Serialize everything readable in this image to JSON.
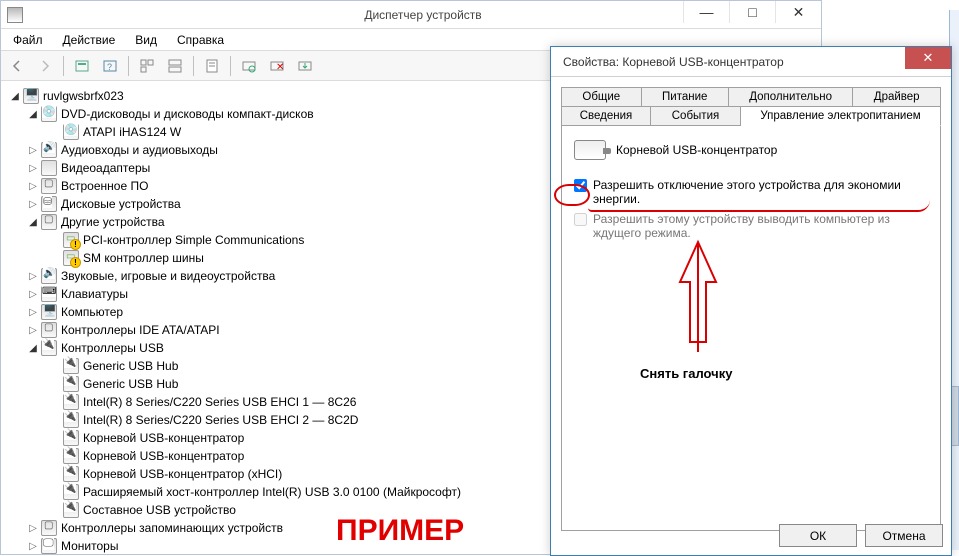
{
  "dm": {
    "title": "Диспетчер устройств",
    "menus": [
      "Файл",
      "Действие",
      "Вид",
      "Справка"
    ],
    "win_controls": {
      "min": "—",
      "max": "□",
      "close": "✕"
    },
    "root": "ruvlgwsbrfx023",
    "categories": [
      {
        "label": "DVD-дисководы и дисководы компакт-дисков",
        "expanded": true,
        "icon": "disc",
        "children": [
          {
            "label": "ATAPI iHAS124   W",
            "icon": "disc"
          }
        ]
      },
      {
        "label": "Аудиовходы и аудиовыходы",
        "icon": "sound"
      },
      {
        "label": "Видеоадаптеры",
        "icon": "video"
      },
      {
        "label": "Встроенное ПО",
        "icon": "chip"
      },
      {
        "label": "Дисковые устройства",
        "icon": "disk"
      },
      {
        "label": "Другие устройства",
        "expanded": true,
        "icon": "chip",
        "children": [
          {
            "label": "PCI-контроллер Simple Communications",
            "icon": "card",
            "warn": true
          },
          {
            "label": "SM контроллер шины",
            "icon": "card",
            "warn": true
          }
        ]
      },
      {
        "label": "Звуковые, игровые и видеоустройства",
        "icon": "sound"
      },
      {
        "label": "Клавиатуры",
        "icon": "keyboard"
      },
      {
        "label": "Компьютер",
        "icon": "computer"
      },
      {
        "label": "Контроллеры IDE ATA/ATAPI",
        "icon": "chip"
      },
      {
        "label": "Контроллеры USB",
        "expanded": true,
        "icon": "usb",
        "children": [
          {
            "label": "Generic USB Hub",
            "icon": "usb"
          },
          {
            "label": "Generic USB Hub",
            "icon": "usb"
          },
          {
            "label": "Intel(R) 8 Series/C220 Series USB EHCI 1 — 8C26",
            "icon": "usb"
          },
          {
            "label": "Intel(R) 8 Series/C220 Series USB EHCI 2 — 8C2D",
            "icon": "usb"
          },
          {
            "label": "Корневой USB-концентратор",
            "icon": "usb"
          },
          {
            "label": "Корневой USB-концентратор",
            "icon": "usb"
          },
          {
            "label": "Корневой USB-концентратор (xHCI)",
            "icon": "usb"
          },
          {
            "label": "Расширяемый хост-контроллер Intel(R) USB 3.0 0100 (Майкрософт)",
            "icon": "usb"
          },
          {
            "label": "Составное USB устройство",
            "icon": "usb"
          }
        ]
      },
      {
        "label": "Контроллеры запоминающих устройств",
        "icon": "chip"
      },
      {
        "label": "Мониторы",
        "icon": "monitor"
      }
    ]
  },
  "prop": {
    "title": "Свойства: Корневой USB-концентратор",
    "tabs_row1": [
      "Общие",
      "Питание",
      "Дополнительно",
      "Драйвер"
    ],
    "tabs_row2": [
      "Сведения",
      "События",
      "Управление электропитанием"
    ],
    "active_tab": "Управление электропитанием",
    "device_name": "Корневой USB-концентратор",
    "check1": "Разрешить отключение этого устройства для экономии энергии.",
    "check2": "Разрешить этому устройству выводить компьютер из ждущего режима.",
    "check1_checked": true,
    "check2_checked": false,
    "ok": "ОК",
    "cancel": "Отмена",
    "close": "✕"
  },
  "annot": {
    "arrow_label": "Снять галочку",
    "primer": "ПРИМЕР"
  }
}
